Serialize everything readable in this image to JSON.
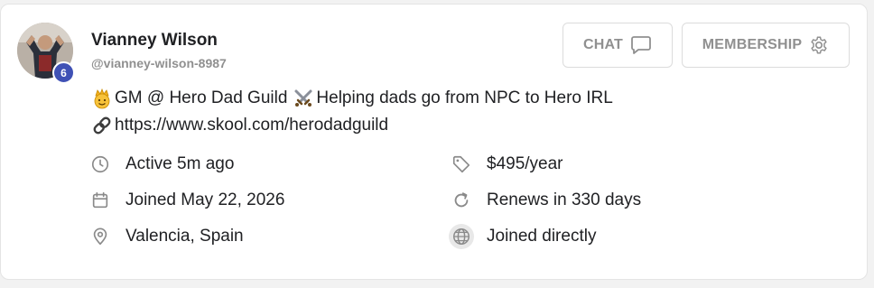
{
  "profile": {
    "name": "Vianney Wilson",
    "handle": "@vianney-wilson-8987",
    "level": "6",
    "bio_line1": "GM @ Hero Dad Guild",
    "bio_line1b": "Helping dads go from NPC to Hero IRL",
    "bio_line2": "https://www.skool.com/herodadguild"
  },
  "buttons": {
    "chat": "CHAT",
    "membership": "MEMBERSHIP"
  },
  "details": {
    "active": "Active 5m ago",
    "joined": "Joined May 22, 2026",
    "location": "Valencia, Spain",
    "price": "$495/year",
    "renews": "Renews in 330 days",
    "joined_via": "Joined directly"
  },
  "icons": {
    "avatar": "avatar-photo",
    "chat": "chat-bubble-icon",
    "membership": "gear-icon",
    "active": "clock-icon",
    "joined": "calendar-icon",
    "location": "location-pin-icon",
    "price": "tag-icon",
    "renews": "refresh-icon",
    "joined_via": "globe-icon"
  },
  "colors": {
    "badge": "#3f51b5",
    "muted": "#909090",
    "text": "#202124"
  }
}
